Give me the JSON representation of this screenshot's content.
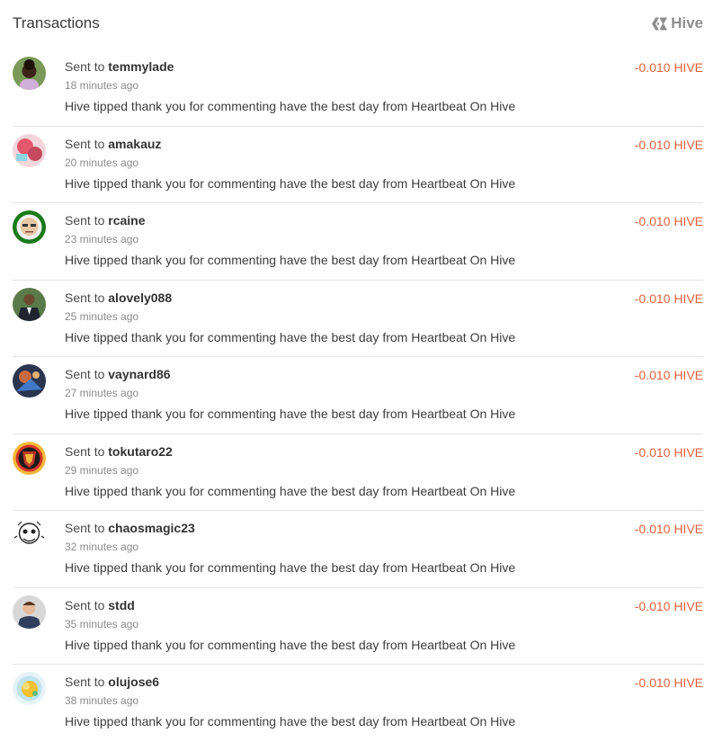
{
  "header": {
    "title": "Transactions",
    "brand": "Hive"
  },
  "transactions": [
    {
      "prefix": "Sent to",
      "user": "temmylade",
      "time": "18 minutes ago",
      "memo": "Hive tipped thank you for commenting have the best day from Heartbeat On Hive",
      "amount": "-0.010 HIVE",
      "avatar_icon": "person-portrait-icon"
    },
    {
      "prefix": "Sent to",
      "user": "amakauz",
      "time": "20 minutes ago",
      "memo": "Hive tipped thank you for commenting have the best day from Heartbeat On Hive",
      "amount": "-0.010 HIVE",
      "avatar_icon": "pink-abstract-icon"
    },
    {
      "prefix": "Sent to",
      "user": "rcaine",
      "time": "23 minutes ago",
      "memo": "Hive tipped thank you for commenting have the best day from Heartbeat On Hive",
      "amount": "-0.010 HIVE",
      "avatar_icon": "cartoon-face-icon"
    },
    {
      "prefix": "Sent to",
      "user": "alovely088",
      "time": "25 minutes ago",
      "memo": "Hive tipped thank you for commenting have the best day from Heartbeat On Hive",
      "amount": "-0.010 HIVE",
      "avatar_icon": "person-suit-icon"
    },
    {
      "prefix": "Sent to",
      "user": "vaynard86",
      "time": "27 minutes ago",
      "memo": "Hive tipped thank you for commenting have the best day from Heartbeat On Hive",
      "amount": "-0.010 HIVE",
      "avatar_icon": "fantasy-art-icon"
    },
    {
      "prefix": "Sent to",
      "user": "tokutaro22",
      "time": "29 minutes ago",
      "memo": "Hive tipped thank you for commenting have the best day from Heartbeat On Hive",
      "amount": "-0.010 HIVE",
      "avatar_icon": "emblem-badge-icon"
    },
    {
      "prefix": "Sent to",
      "user": "chaosmagic23",
      "time": "32 minutes ago",
      "memo": "Hive tipped thank you for commenting have the best day from Heartbeat On Hive",
      "amount": "-0.010 HIVE",
      "avatar_icon": "sketch-face-icon"
    },
    {
      "prefix": "Sent to",
      "user": "stdd",
      "time": "35 minutes ago",
      "memo": "Hive tipped thank you for commenting have the best day from Heartbeat On Hive",
      "amount": "-0.010 HIVE",
      "avatar_icon": "person-photo-icon"
    },
    {
      "prefix": "Sent to",
      "user": "olujose6",
      "time": "38 minutes ago",
      "memo": "Hive tipped thank you for commenting have the best day from Heartbeat On Hive",
      "amount": "-0.010 HIVE",
      "avatar_icon": "yellow-blob-icon"
    }
  ],
  "colors": {
    "amount": "#e3613b",
    "divider": "#e3e3e3",
    "brand": "#8e8e8e"
  }
}
